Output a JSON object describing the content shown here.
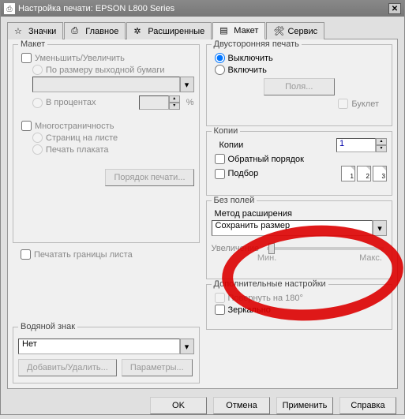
{
  "window": {
    "title": "Настройка печати: EPSON L800 Series"
  },
  "tabs": {
    "icons": "Значки",
    "main": "Главное",
    "advanced": "Расширенные",
    "layout": "Макет",
    "service": "Сервис"
  },
  "layout": {
    "legend": "Макет",
    "reduce_enlarge": "Уменьшить/Увеличить",
    "fit_output": "По размеру выходной бумаги",
    "percent": "В процентах",
    "pct_unit": "%",
    "multipage": "Многостраничность",
    "pages_per_sheet": "Страниц на листе",
    "poster": "Печать плаката",
    "print_order": "Порядок печати...",
    "print_borders": "Печатать границы листа"
  },
  "watermark": {
    "legend": "Водяной знак",
    "none": "Нет",
    "add_delete": "Добавить/Удалить...",
    "params": "Параметры..."
  },
  "duplex": {
    "legend": "Двусторонняя печать",
    "off": "Выключить",
    "on": "Включить",
    "margins": "Поля...",
    "booklet": "Буклет"
  },
  "copies": {
    "legend": "Копии",
    "label": "Копии",
    "value": "1",
    "reverse": "Обратный порядок",
    "collate": "Подбор"
  },
  "borderless": {
    "legend": "Без полей",
    "method": "Метод расширения",
    "method_value": "Сохранить размер",
    "enlarge": "Увеличение",
    "min": "Мин.",
    "max": "Макс."
  },
  "extras": {
    "legend": "Дополнительные настройки",
    "rotate": "Повернуть на 180°",
    "mirror": "Зеркально"
  },
  "buttons": {
    "ok": "OK",
    "cancel": "Отмена",
    "apply": "Применить",
    "help": "Справка"
  }
}
